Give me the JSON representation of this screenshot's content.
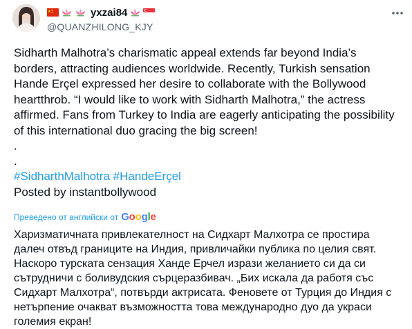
{
  "user": {
    "display_name": "yxzai84",
    "handle": "@QUANZHILONG_KJY",
    "name_emojis": [
      "china-flag",
      "lotus",
      "lotus",
      "lotus",
      "singapore-flag"
    ]
  },
  "tweet": {
    "paragraph": "Sidharth Malhotra’s charismatic appeal extends far beyond India’s borders, attracting audiences worldwide. Recently, Turkish sensation Hande Erçel expressed her desire to collaborate with the Bollywood heartthrob. “I would like to work with Sidharth Malhotra,” the actress affirmed. Fans from Turkey to India are eagerly anticipating the possibility of this international duo gracing the big screen!",
    "dot1": ".",
    "dot2": ".",
    "hashtag1": "#SidharthMalhotra",
    "hashtag2": "#HandeErçel",
    "posted_by": "Posted by instantbollywood"
  },
  "translation": {
    "label": "Преведено от английски от",
    "provider": "Google",
    "text": "Харизматичната привлекателност на Сидхарт Малхотра се простира далеч отвъд границите на Индия, привличайки публика по целия свят. Наскоро турската сензация Ханде Ерчел изрази желанието си да си сътрудничи с боливудския сърцеразбивач. „Бих искала да работя със Сидхарт Малхотра“, потвърди актрисата. Феновете от Турция до Индия с нетърпение очакват възможността това международно дуо да украси големия екран!"
  },
  "colors": {
    "link": "#1d9bf0",
    "text": "#0f1419",
    "secondary": "#536471",
    "google_blue": "#4285F4",
    "google_red": "#EA4335",
    "google_yellow": "#FBBC05",
    "google_green": "#34A853"
  },
  "icons": {
    "more": "more-horizontal-icon"
  }
}
